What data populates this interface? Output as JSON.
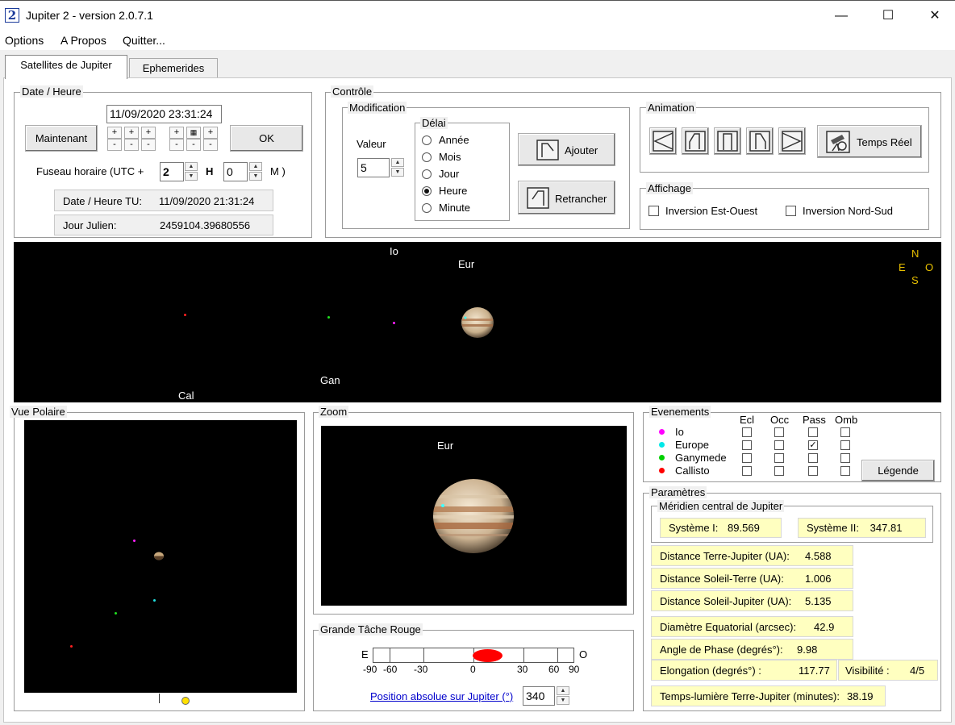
{
  "window": {
    "title": "Jupiter 2 - version 2.0.7.1",
    "icon_text": "2",
    "controls": {
      "minimize": "—",
      "maximize": "☐",
      "close": "✕"
    }
  },
  "menu": [
    "Options",
    "A Propos",
    "Quitter..."
  ],
  "tabs": [
    {
      "label": "Satellites de Jupiter",
      "active": true
    },
    {
      "label": "Ephemerides",
      "active": false
    }
  ],
  "date_heure": {
    "label": "Date / Heure",
    "datetime_value": "11/09/2020 23:31:24",
    "now_button": "Maintenant",
    "ok_button": "OK",
    "plus": "+",
    "minus": "-",
    "timezone_label": "Fuseau horaire (UTC +",
    "tz_hours": "2",
    "tz_h_label": "H",
    "tz_minutes": "0",
    "tz_m_label": "M  )",
    "tu_label": "Date / Heure TU:",
    "tu_value": "11/09/2020 21:31:24",
    "julian_label": "Jour Julien:",
    "julian_value": "2459104.39680556"
  },
  "controle": {
    "label": "Contrôle",
    "modification_label": "Modification",
    "valeur_label": "Valeur",
    "valeur_value": "5",
    "delai_label": "Délai",
    "delai_options": [
      {
        "label": "Année",
        "selected": false
      },
      {
        "label": "Mois",
        "selected": false
      },
      {
        "label": "Jour",
        "selected": false
      },
      {
        "label": "Heure",
        "selected": true
      },
      {
        "label": "Minute",
        "selected": false
      }
    ],
    "ajouter_button": "Ajouter",
    "retrancher_button": "Retrancher",
    "animation_label": "Animation",
    "temps_reel_button": "Temps Réel",
    "affichage_label": "Affichage",
    "inversion_eo": "Inversion Est-Ouest",
    "inversion_ns": "Inversion Nord-Sud"
  },
  "sky_view": {
    "labels": {
      "io": "Io",
      "europa": "Eur",
      "ganymede": "Gan",
      "callisto": "Cal"
    },
    "compass": {
      "n": "N",
      "e": "E",
      "o": "O",
      "s": "S"
    }
  },
  "vue_polaire": {
    "label": "Vue Polaire"
  },
  "zoom": {
    "label": "Zoom",
    "moon_label": "Eur"
  },
  "gtr": {
    "label": "Grande Tâche Rouge",
    "left_letter": "E",
    "right_letter": "O",
    "ticks": [
      "-90",
      "-60",
      "-30",
      "0",
      "30",
      "60",
      "90"
    ],
    "link_label": "Position absolue sur Jupiter (°)",
    "position_value": "340"
  },
  "evenements": {
    "label": "Evenements",
    "columns": [
      "Ecl",
      "Occ",
      "Pass",
      "Omb"
    ],
    "rows": [
      {
        "name": "Io",
        "color": "#ff00ff",
        "checks": [
          false,
          false,
          false,
          false
        ]
      },
      {
        "name": "Europe",
        "color": "#00e8e8",
        "checks": [
          false,
          false,
          true,
          false
        ]
      },
      {
        "name": "Ganymede",
        "color": "#00d000",
        "checks": [
          false,
          false,
          false,
          false
        ]
      },
      {
        "name": "Callisto",
        "color": "#ff0000",
        "checks": [
          false,
          false,
          false,
          false
        ]
      }
    ],
    "legende_button": "Légende"
  },
  "parametres": {
    "label": "Paramètres",
    "meridien_label": "Méridien central de Jupiter",
    "systeme1_label": "Système I:",
    "systeme1_value": "89.569",
    "systeme2_label": "Système II:",
    "systeme2_value": "347.81",
    "rows": [
      {
        "label": "Distance Terre-Jupiter (UA):",
        "value": "4.588"
      },
      {
        "label": "Distance Soleil-Terre (UA):",
        "value": "1.006"
      },
      {
        "label": "Distance Soleil-Jupiter (UA):",
        "value": "5.135"
      },
      {
        "label": "Diamètre Equatorial (arcsec):",
        "value": "42.9"
      },
      {
        "label": "Angle de Phase (degrés°):",
        "value": "9.98"
      }
    ],
    "elongation_label": "Elongation (degrés°) :",
    "elongation_value": "117.77",
    "visibilite_label": "Visibilité :",
    "visibilite_value": "4/5",
    "temps_lumiere_label": "Temps-lumière Terre-Jupiter (minutes):",
    "temps_lumiere_value": "38.19"
  }
}
